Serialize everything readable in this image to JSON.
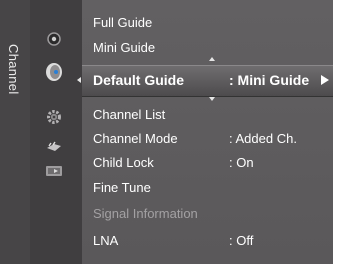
{
  "sidebar": {
    "label": "Channel"
  },
  "icons": [
    "picture-icon",
    "channel-dish-icon",
    "setup-gear-icon",
    "input-icon",
    "application-icon"
  ],
  "menu": {
    "items": [
      {
        "label": "Full Guide",
        "value": ""
      },
      {
        "label": "Mini Guide",
        "value": ""
      },
      {
        "label": "Default Guide",
        "value": ": Mini Guide",
        "selected": true
      },
      {
        "label": "Channel List",
        "value": ""
      },
      {
        "label": "Channel Mode",
        "value": ": Added Ch."
      },
      {
        "label": "Child Lock",
        "value": ": On"
      },
      {
        "label": "Fine Tune",
        "value": ""
      },
      {
        "label": "Signal Information",
        "value": "",
        "disabled": true
      },
      {
        "label": "LNA",
        "value": ": Off"
      }
    ]
  },
  "colors": {
    "screen_bg": "#525052",
    "highlight": "#5e5c5e",
    "text": "#ffffff",
    "disabled_text": "#a3a1a3"
  }
}
